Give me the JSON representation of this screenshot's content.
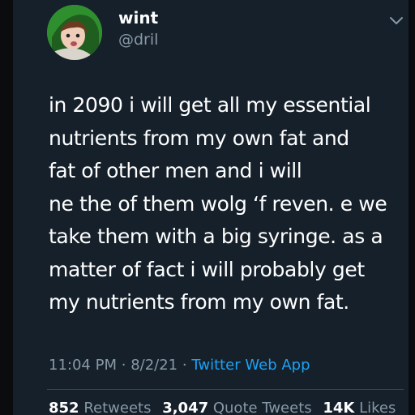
{
  "tweet": {
    "display_name": "wint",
    "handle": "@dril",
    "avatar_icon": "avatar-image",
    "menu_icon": "chevron-down-icon",
    "text_lines": [
      "in 2090 i will get all my essential",
      "nutrients from my own fat and",
      "fat of other men and i will",
      "ne the of them wolg ‘f reven. e we",
      "take them with a big syringe. as a",
      "matter of fact i will probably get",
      "my nutrients from my own fat."
    ],
    "time": "11:04 PM",
    "separator": "·",
    "date": "8/2/21",
    "source": "Twitter Web App",
    "retweets_count": "852",
    "retweets_label": "Retweets",
    "quote_count": "3,047",
    "quote_label": "Quote Tweets",
    "likes_count": "14K",
    "likes_label": "Likes"
  },
  "colors": {
    "background": "#15202b",
    "secondary_text": "#8899a6",
    "link": "#1da1f2"
  }
}
